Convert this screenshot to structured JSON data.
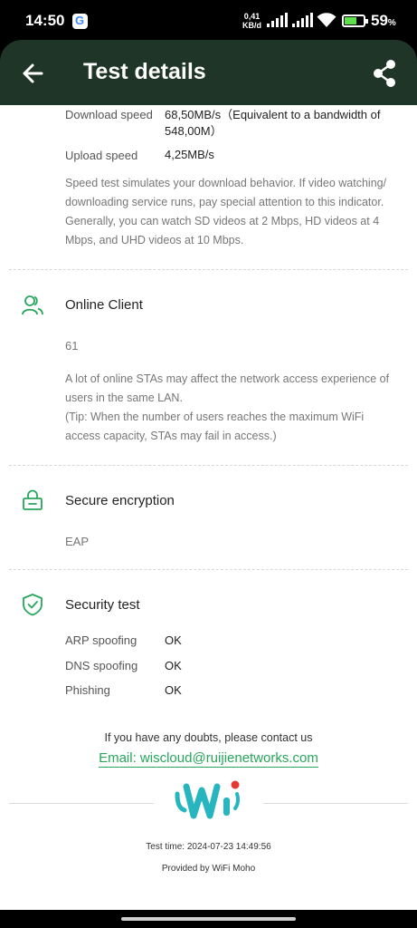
{
  "status_bar": {
    "time": "14:50",
    "g_icon": "G",
    "net_speed_value": "0,41",
    "net_speed_unit": "KB/d",
    "battery_value": "59",
    "battery_unit": "%"
  },
  "header": {
    "title": "Test details",
    "back_icon": "arrow-left-icon",
    "share_icon": "share-icon"
  },
  "speed": {
    "download_label": "Download speed",
    "download_value": "68,50MB/s（Equivalent to a bandwidth of 548,00M）",
    "upload_label": "Upload speed",
    "upload_value": "4,25MB/s",
    "note": "Speed test simulates your download behavior. If video watching/ downloading service runs, pay special attention to this indicator. Generally, you can watch SD videos at 2 Mbps, HD videos at 4 Mbps, and UHD videos at 10 Mbps."
  },
  "online_client": {
    "title": "Online Client",
    "icon": "users-icon",
    "value": "61",
    "note": "A lot of online STAs may affect the network access experience of users in the same LAN.",
    "tip": "(Tip: When the number of users reaches the maximum WiFi access capacity, STAs may fail in access.)"
  },
  "encryption": {
    "title": "Secure encryption",
    "icon": "lock-icon",
    "value": "EAP"
  },
  "security": {
    "title": "Security test",
    "icon": "shield-check-icon",
    "rows": [
      {
        "label": "ARP spoofing",
        "value": "OK"
      },
      {
        "label": "DNS spoofing",
        "value": "OK"
      },
      {
        "label": "Phishing",
        "value": "OK"
      }
    ]
  },
  "contact": {
    "prompt": "If you have any doubts, please contact us",
    "email": "Email: wiscloud@ruijienetworks.com"
  },
  "footer": {
    "logo": "wifi-moho-logo",
    "test_time": "Test time: 2024-07-23 14:49:56",
    "provider": "Provided by WiFi Moho"
  },
  "colors": {
    "header_bg": "#1f3527",
    "accent_green": "#27a65b",
    "logo_teal": "#27b5bf",
    "logo_red": "#e53935"
  }
}
